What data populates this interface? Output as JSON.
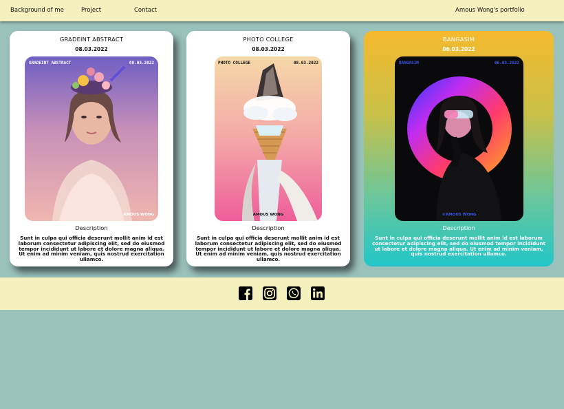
{
  "nav": {
    "links": [
      "Background of me",
      "Project",
      "Contact"
    ],
    "brand": "Amous Wong's portfolio"
  },
  "cards": [
    {
      "title": "GRADEINT ABSTRACT",
      "date": "08.03.2022",
      "poster_title": "GRADEINT ABSTRACT",
      "poster_date": "08.03.2022",
      "poster_author": "AMOUS WONG",
      "description_title": "Description",
      "description": "Sunt in culpa qui officia deserunt mollit anim id est laborum consectetur adipiscing elit, sed do eiusmod tempor incididunt ut labore et dolore magna aliqua. Ut enim ad minim veniam, quis nostrud exercitation ullamco."
    },
    {
      "title": "PHOTO COLLEGE",
      "date": "08.03.2022",
      "poster_title": "PHOTO COLLEGE",
      "poster_date": "08.03.2022",
      "poster_author": "AMOUS WONG",
      "description_title": "Description",
      "description": "Sunt in culpa qui officia deserunt mollit anim id est laborum consectetur adipiscing elit, sed do eiusmod tempor incididunt ut labore et dolore magna aliqua. Ut enim ad minim veniam, quis nostrud exercitation ullamco."
    },
    {
      "title": "BANGASIM",
      "date": "06.03.2022",
      "poster_title": "BANGASIM",
      "poster_date": "06.03.2022",
      "poster_author": "©AMOUS WONG",
      "description_title": "Description",
      "description": "Sunt in culpa qui officia deserunt mollit anim id est laborum consectetur adipiscing elit, sed do eiusmod tempor incididunt ut labore et dolore magna aliqua. Ut enim ad minim veniam, quis nostrud exercitation ullamco."
    }
  ],
  "footer": {
    "icons": [
      "facebook-icon",
      "instagram-icon",
      "whatsapp-icon",
      "linkedin-icon"
    ]
  },
  "colors": {
    "background": "#9bc1bd",
    "bar": "#f4f1bf",
    "card": "#ffffff",
    "accent_card_top": "#f5b92e",
    "accent_card_bottom": "#22c6c9",
    "poster_blue_text": "#3a55e8"
  }
}
